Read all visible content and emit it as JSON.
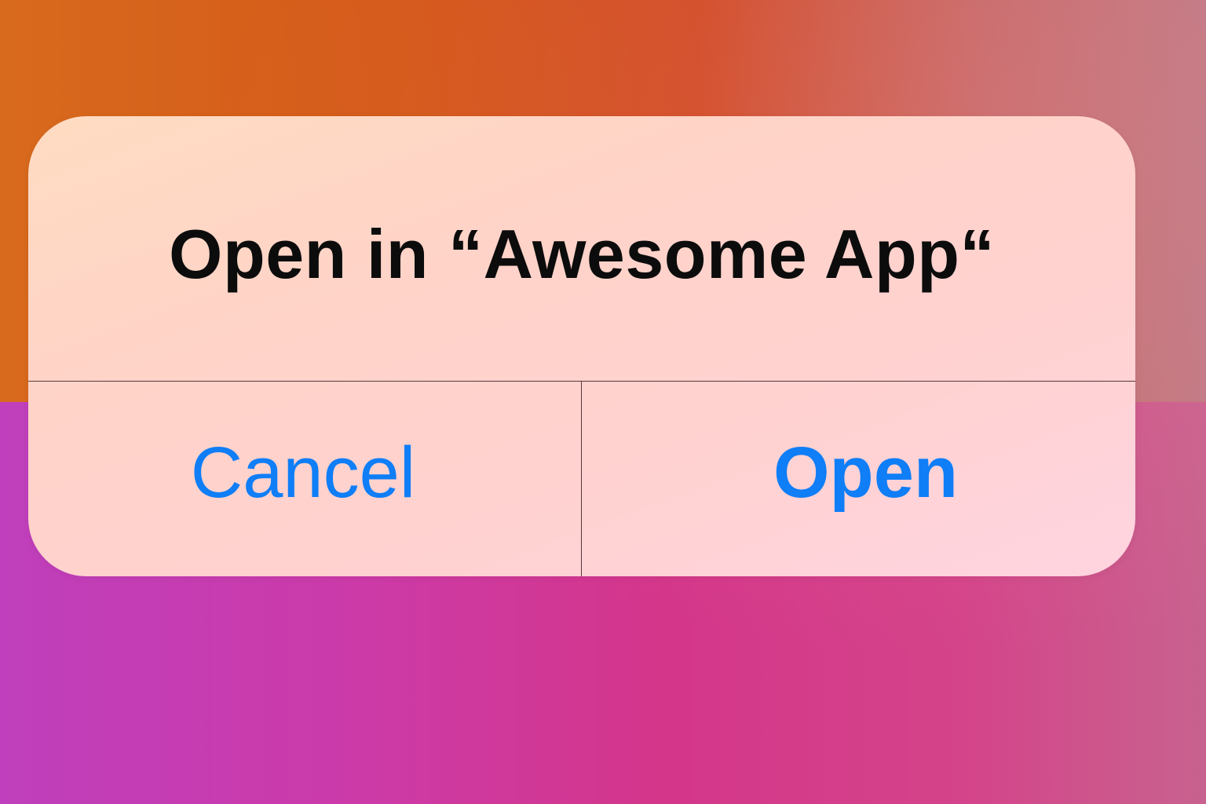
{
  "alert": {
    "title": "Open in “Awesome App“",
    "buttons": {
      "cancel_label": "Cancel",
      "open_label": "Open"
    }
  },
  "colors": {
    "accent": "#0f7ef7",
    "title_text": "#0c0c0c",
    "background_top": "#d45818",
    "background_bottom": "#cc3aa8"
  }
}
